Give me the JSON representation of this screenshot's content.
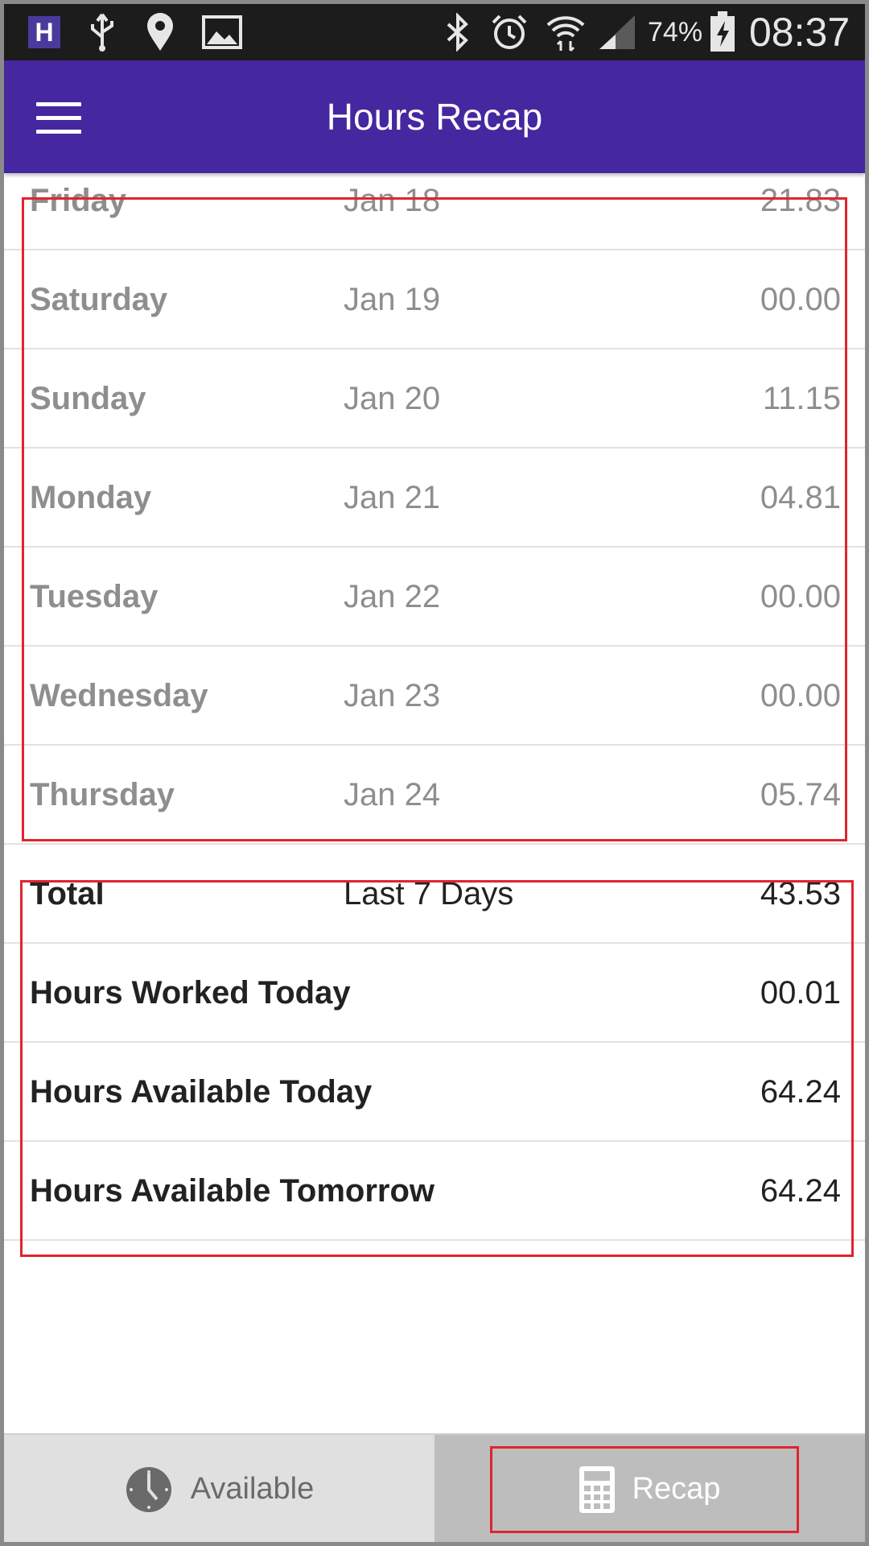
{
  "status_bar": {
    "app_badge": "H",
    "battery": "74%",
    "time": "08:37"
  },
  "app_bar": {
    "title": "Hours Recap"
  },
  "days": [
    {
      "day": "Friday",
      "date": "Jan 18",
      "hours": "21.83"
    },
    {
      "day": "Saturday",
      "date": "Jan 19",
      "hours": "00.00"
    },
    {
      "day": "Sunday",
      "date": "Jan 20",
      "hours": "11.15"
    },
    {
      "day": "Monday",
      "date": "Jan 21",
      "hours": "04.81"
    },
    {
      "day": "Tuesday",
      "date": "Jan 22",
      "hours": "00.00"
    },
    {
      "day": "Wednesday",
      "date": "Jan 23",
      "hours": "00.00"
    },
    {
      "day": "Thursday",
      "date": "Jan 24",
      "hours": "05.74"
    }
  ],
  "summary": [
    {
      "label": "Total",
      "period": "Last 7 Days",
      "hours": "43.53"
    },
    {
      "label": "Hours Worked Today",
      "period": "",
      "hours": "00.01"
    },
    {
      "label": "Hours Available Today",
      "period": "",
      "hours": "64.24"
    },
    {
      "label": "Hours Available Tomorrow",
      "period": "",
      "hours": "64.24"
    }
  ],
  "bottom_nav": {
    "available_label": "Available",
    "recap_label": "Recap",
    "active_tab": "Recap"
  },
  "colors": {
    "app_bar": "#4527a0",
    "highlight": "#e0242e",
    "muted_text": "#8e8e8e"
  }
}
